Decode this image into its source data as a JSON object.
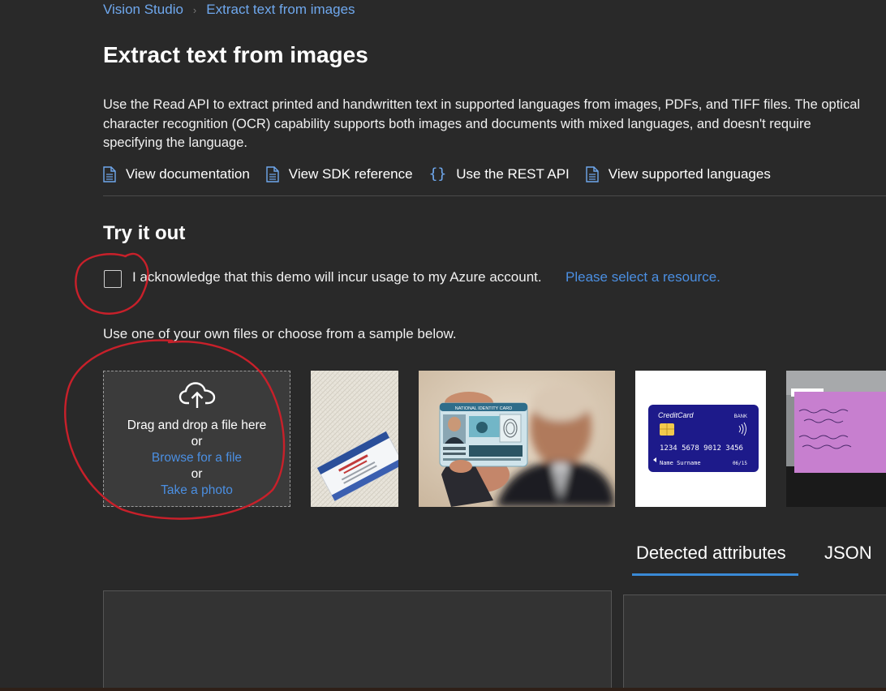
{
  "breadcrumb": {
    "root": "Vision Studio",
    "current": "Extract text from images"
  },
  "page": {
    "title": "Extract text from images",
    "description": "Use the Read API to extract printed and handwritten text in supported languages from images, PDFs, and TIFF files. The optical character recognition (OCR) capability supports both images and documents with mixed languages, and doesn't require specifying the language."
  },
  "links": {
    "documentation": "View documentation",
    "sdk": "View SDK reference",
    "rest": "Use the REST API",
    "languages": "View supported languages"
  },
  "try_it_out": {
    "title": "Try it out",
    "acknowledge_text": "I acknowledge that this demo will incur usage to my Azure account.",
    "acknowledge_checked": false,
    "select_resource": "Please select a resource.",
    "use_files_text": "Use one of your own files or choose from a sample below."
  },
  "dropzone": {
    "drag_text": "Drag and drop a file here",
    "or1": "or",
    "browse": "Browse for a file",
    "or2": "or",
    "photo": "Take a photo"
  },
  "samples": {
    "id_card_header": "NATIONAL IDENTITY CARD",
    "credit_card_brand": "CreditCard",
    "credit_card_bank": "BANK",
    "credit_card_number": "1234 5678 9012 3456",
    "credit_card_name": "Name Surname",
    "credit_card_expiry": "06/15"
  },
  "tabs": {
    "detected": "Detected attributes",
    "json": "JSON",
    "active": "detected"
  },
  "colors": {
    "background": "#292929",
    "accent": "#4b8fe2",
    "annotation": "#c8202a"
  },
  "icons": {
    "doc": "document-icon",
    "braces": "code-braces-icon",
    "upload": "cloud-upload-icon"
  }
}
